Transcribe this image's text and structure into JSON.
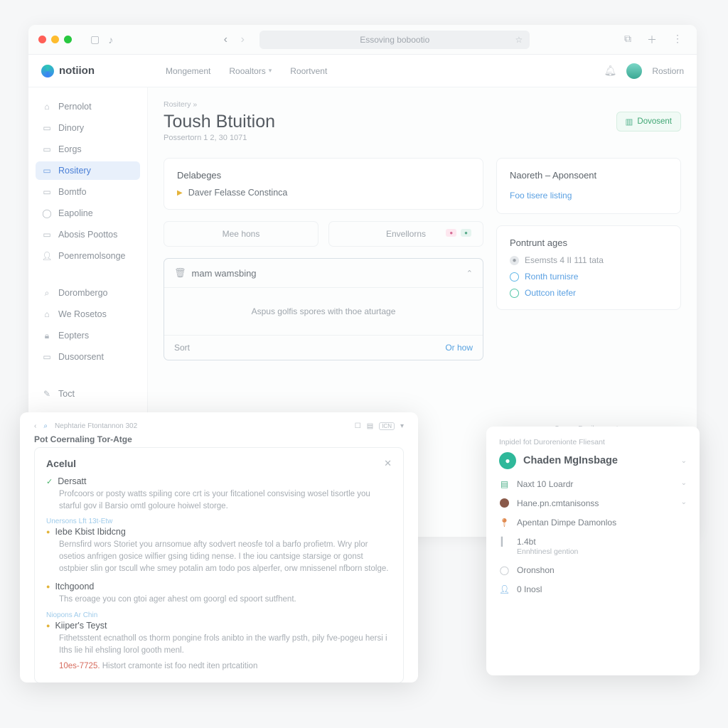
{
  "titlebar": {
    "search_placeholder": "Essoving bobootio"
  },
  "brand": {
    "name": "notiion"
  },
  "tabs": [
    {
      "label": "Mongement"
    },
    {
      "label": "Rooaltors",
      "caret": true
    },
    {
      "label": "Roortvent"
    }
  ],
  "header": {
    "username": "Rostiorn"
  },
  "sidebar": {
    "items": [
      {
        "icon": "home-icon",
        "label": "Pernolot"
      },
      {
        "icon": "doc-icon",
        "label": "Dinory"
      },
      {
        "icon": "doc-icon",
        "label": "Eorgs"
      },
      {
        "icon": "doc-icon",
        "label": "Rositery",
        "active": true
      },
      {
        "icon": "doc-icon",
        "label": "Bomtfo"
      },
      {
        "icon": "circle-icon",
        "label": "Eapoline"
      },
      {
        "icon": "doc-icon",
        "label": "Abosis Poottos"
      },
      {
        "icon": "person-icon",
        "label": "Poenremolsonge"
      }
    ],
    "items2": [
      {
        "icon": "search-icon",
        "label": "Dorombergo"
      },
      {
        "icon": "home-icon",
        "label": "We Rosetos"
      },
      {
        "icon": "lock-icon",
        "label": "Eopters"
      },
      {
        "icon": "doc-icon",
        "label": "Dusoorsent"
      }
    ],
    "items3": [
      {
        "icon": "pencil-icon",
        "label": "Toct"
      }
    ]
  },
  "page": {
    "crumb": "Rositery »",
    "title": "Toush Btuition",
    "subtitle": "Possertorn 1 2, 30 1071",
    "download_label": "Dovosent"
  },
  "left": {
    "card1": {
      "title": "Delabeges",
      "row": "Daver Felasse Constinca"
    },
    "twotabs": [
      "Mee hons",
      "Envellorns"
    ],
    "panel": {
      "icon": "trash-icon",
      "title": "mam wamsbing",
      "body": "Aspus golfis spores with thoe aturtage",
      "sort": "Sort",
      "ok": "Or how"
    }
  },
  "right": {
    "card1": {
      "title": "Naoreth – Aponsoent",
      "link": "Foo tisere listing"
    },
    "card2": {
      "title": "Pontrunt ages",
      "items": [
        {
          "color": "#b9bfc5",
          "label": "Esemsts 4 II 111 tata"
        },
        {
          "color": "#63b8e8",
          "label": "Ronth turnisre"
        },
        {
          "color": "#55c6a8",
          "label": "Outtcon itefer"
        }
      ]
    }
  },
  "footer_note": "Scross Devil arcourts",
  "float_left": {
    "toolbar_label": "Nephtarie Ftontannon 302",
    "heading": "Pot Coernaling Tor-Atge",
    "modal_title": "Acelul",
    "entries": [
      {
        "status": "check",
        "title": "Dersatt",
        "body": "Profcoors or posty watts spiling core crt is your fitcationel consvising wosel tisortle you starful gov il Barsio omtl goloure hoiwel storge."
      },
      {
        "meta": "Unersons  Lft 13t-Etw",
        "status": "dot",
        "title": "Iebe Kbist Ibidcng",
        "body": "Bernsfird wors Storiet you arnsomue afty sodvert neosfe tol a barfo profietm.  Wry plor osetios anfrigen gosice wilfier gsing tiding nense. I the iou cantsige starsige or gonst ostpbier slin gor tscull whe smey potalin am todo pos alperfer,  orw mnissenel nfborn stolge."
      },
      {
        "status": "dot",
        "title": "Itchgoond",
        "body": "Ths eroage you con gtoi ager ahest om goorgl ed spoort sutfhent."
      },
      {
        "meta": "Niopons  Ar Chin",
        "status": "check",
        "title": "Kiiper's Teyst",
        "body": "Fithetsstent ecnatholl os thorm pongine frols anibto in the warfly psth, pily fve-pogeu hersi i Iths lie hil ehsling lorol gooth menl."
      }
    ],
    "footer_red": "10es-7725.",
    "footer_grey": "Histort cramonte ist foo nedt iten prtcatition"
  },
  "float_right": {
    "crumb": "Inpidel fot Durorenionte Fliesant",
    "name": "Chaden MgInsbage",
    "items": [
      {
        "icon": "card-icon",
        "color": "#4fb08a",
        "label": "Naxt 10 Loardr",
        "chev": true
      },
      {
        "icon": "avatar-icon",
        "color": "#8a5a4a",
        "label": "Hane.pn.cmtanisonss",
        "chev": true
      },
      {
        "icon": "pin-icon",
        "color": "#e08a4f",
        "label": "Apentan Dimpe Damonlos"
      },
      {
        "icon": "bar-icon",
        "color": "#b9bfc5",
        "label": "1.4bt",
        "sub": "Ennhtinesl gention"
      },
      {
        "icon": "circle-icon",
        "color": "#b9bfc5",
        "label": "Oronshon"
      },
      {
        "icon": "person-icon",
        "color": "#5fa7e0",
        "label": "0 Inosl"
      }
    ]
  }
}
